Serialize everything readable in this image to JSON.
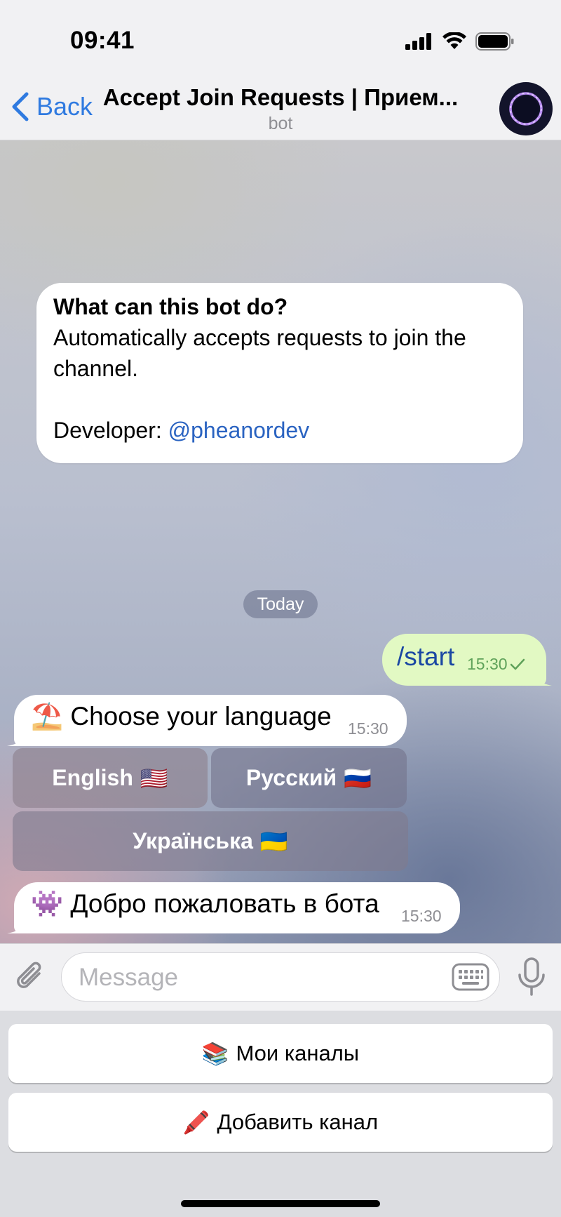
{
  "status_bar": {
    "time": "09:41"
  },
  "header": {
    "back_label": "Back",
    "title": "Accept Join Requests | Прием...",
    "subtitle": "bot"
  },
  "info_card": {
    "title": "What can this bot do?",
    "description": "Automatically accepts requests to join the channel.",
    "developer_label": "Developer: ",
    "developer_link": "@pheanordev"
  },
  "date_separator": "Today",
  "messages": [
    {
      "direction": "out",
      "text": "/start",
      "time": "15:30",
      "status": "read-check"
    },
    {
      "direction": "in",
      "emoji": "⛱️",
      "text": "Choose your language",
      "time": "15:30"
    },
    {
      "direction": "in",
      "emoji": "👾",
      "text": "Добро пожаловать в бота",
      "time": "15:30"
    }
  ],
  "inline_keyboard": {
    "english": {
      "label": "English",
      "flag": "🇺🇸"
    },
    "russian": {
      "label": "Русский",
      "flag": "🇷🇺"
    },
    "ukrainian": {
      "label": "Українська",
      "flag": "🇺🇦"
    }
  },
  "input": {
    "placeholder": "Message"
  },
  "reply_keyboard": [
    {
      "emoji": "📚",
      "label": "Мои каналы"
    },
    {
      "emoji": "🖍️",
      "label": "Добавить канал"
    }
  ],
  "colors": {
    "accent": "#2f7ae0",
    "outgoing_bubble": "#e2f9c3",
    "link": "#2a63c1",
    "outgoing_time": "#5fa25a"
  }
}
